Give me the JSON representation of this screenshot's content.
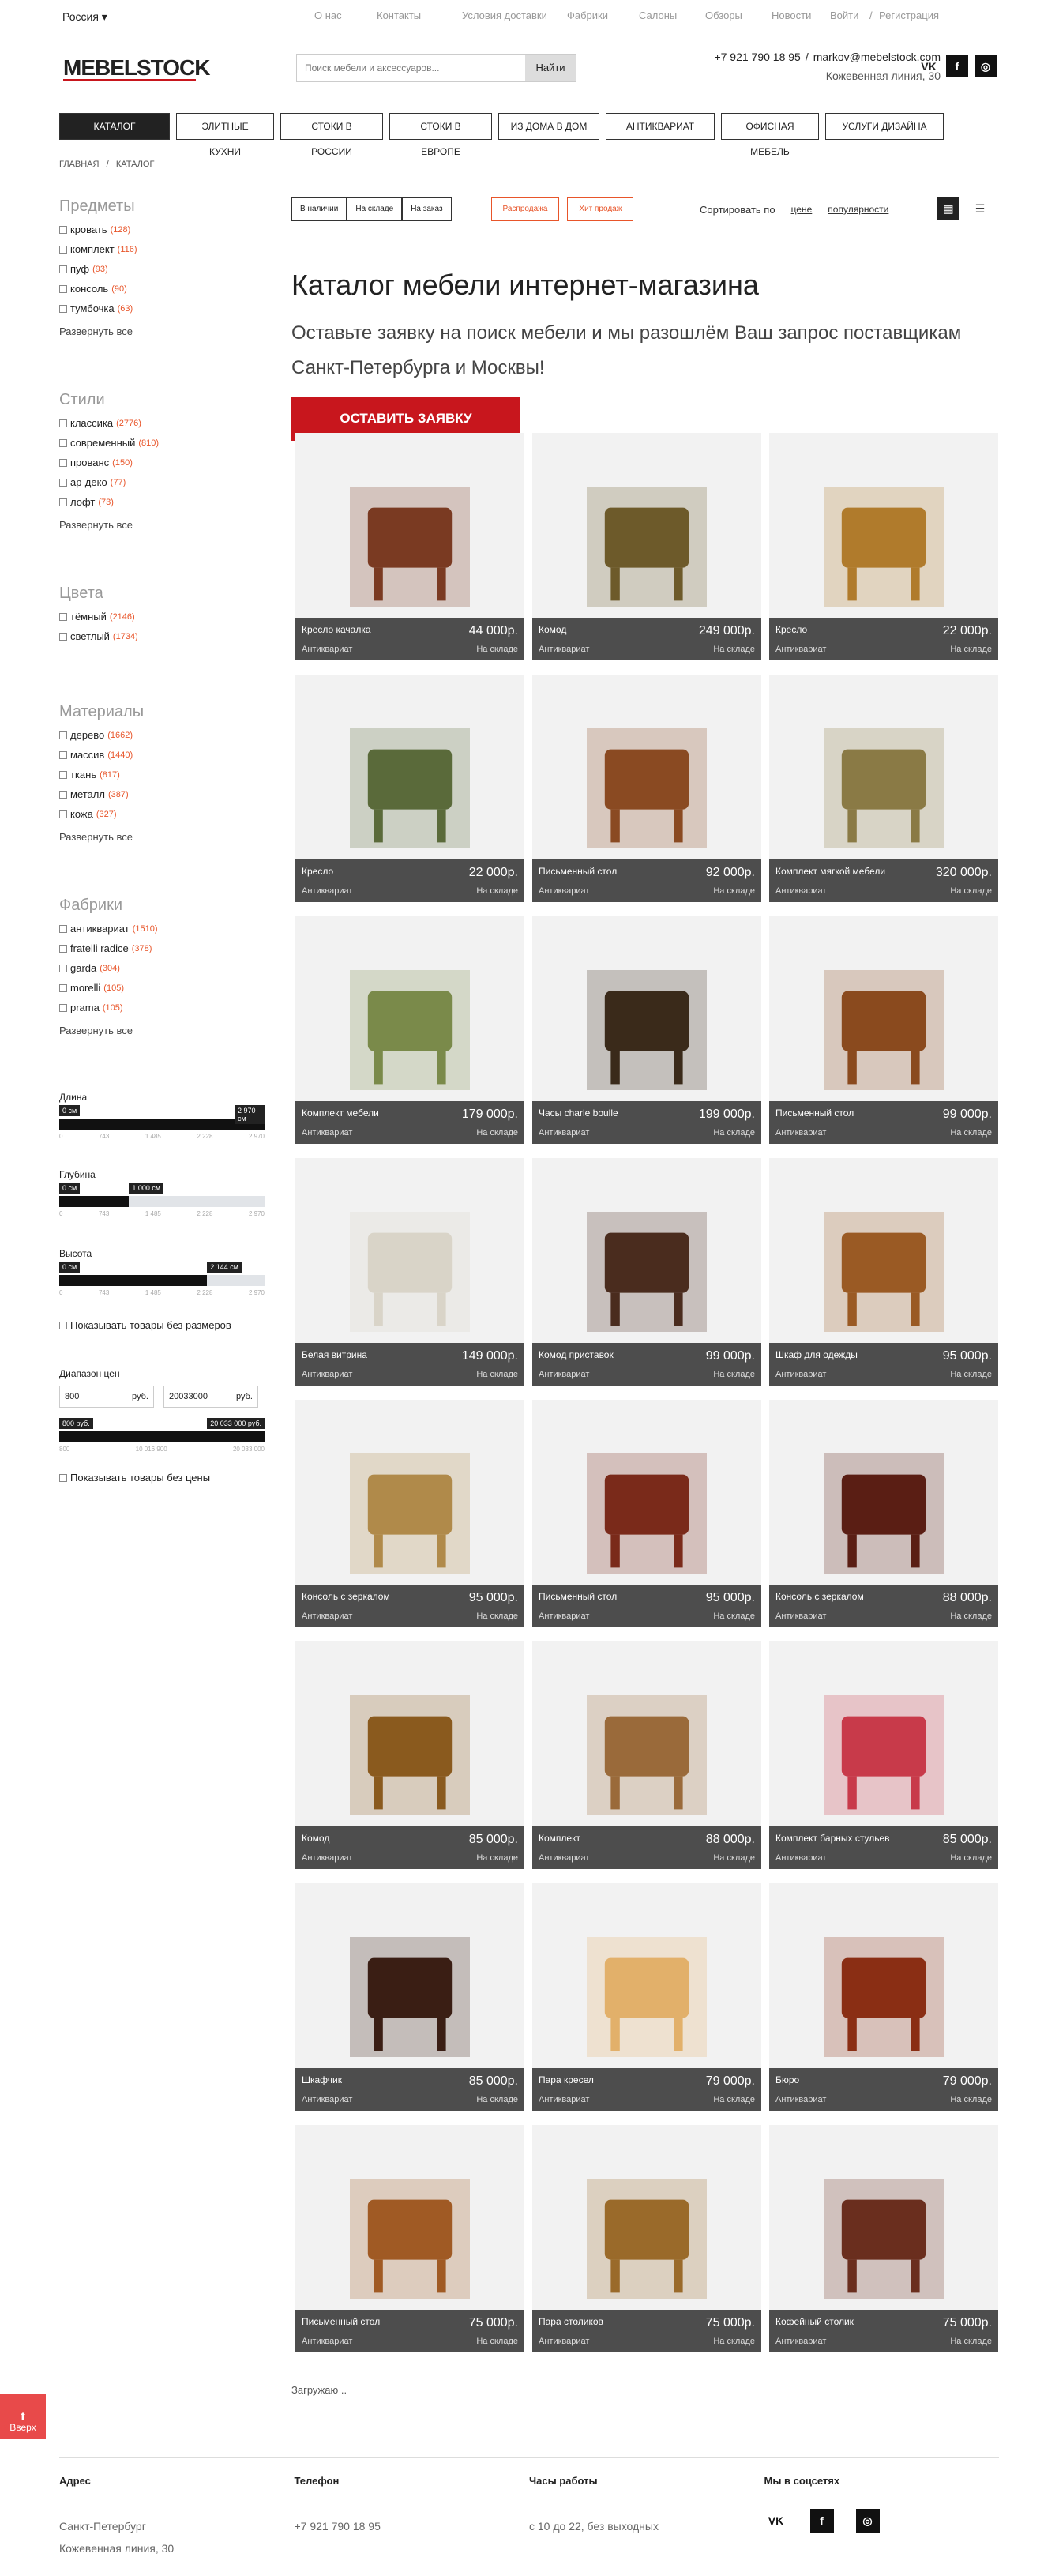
{
  "topbar": {
    "region": "Россия",
    "nav": [
      "О нас",
      "Контакты",
      "Условия доставки",
      "Фабрики",
      "Салоны",
      "Обзоры",
      "Новости",
      "Войти",
      "/",
      "Регистрация"
    ]
  },
  "header": {
    "logo": "MEBELSTOCK",
    "search_placeholder": "Поиск мебели и аксессуаров...",
    "search_button": "Найти",
    "phone": "+7 921 790 18 95",
    "email": "markov@mebelstock.com",
    "address": "Кожевенная линия, 30"
  },
  "mainnav": [
    "КАТАЛОГ",
    "ЭЛИТНЫЕ КУХНИ",
    "СТОКИ В РОССИИ",
    "СТОКИ В ЕВРОПЕ",
    "ИЗ ДОМА В ДОМ",
    "АНТИКВАРИАТ",
    "ОФИСНАЯ МЕБЕЛЬ",
    "УСЛУГИ ДИЗАЙНА"
  ],
  "breadcrumb": {
    "home": "ГЛАВНАЯ",
    "sep": "/",
    "current": "КАТАЛОГ"
  },
  "sidebar": {
    "items": {
      "title": "Предметы",
      "list": [
        {
          "l": "кровать",
          "c": "(128)"
        },
        {
          "l": "комплект",
          "c": "(116)"
        },
        {
          "l": "пуф",
          "c": "(93)"
        },
        {
          "l": "консоль",
          "c": "(90)"
        },
        {
          "l": "тумбочка",
          "c": "(63)"
        }
      ],
      "expand": "Развернуть все"
    },
    "styles": {
      "title": "Стили",
      "list": [
        {
          "l": "классика",
          "c": "(2776)"
        },
        {
          "l": "современный",
          "c": "(810)"
        },
        {
          "l": "прованс",
          "c": "(150)"
        },
        {
          "l": "ар-деко",
          "c": "(77)"
        },
        {
          "l": "лофт",
          "c": "(73)"
        }
      ],
      "expand": "Развернуть все"
    },
    "colors": {
      "title": "Цвета",
      "list": [
        {
          "l": "тёмный",
          "c": "(2146)"
        },
        {
          "l": "светлый",
          "c": "(1734)"
        }
      ]
    },
    "materials": {
      "title": "Материалы",
      "list": [
        {
          "l": "дерево",
          "c": "(1662)"
        },
        {
          "l": "массив",
          "c": "(1440)"
        },
        {
          "l": "ткань",
          "c": "(817)"
        },
        {
          "l": "металл",
          "c": "(387)"
        },
        {
          "l": "кожа",
          "c": "(327)"
        }
      ],
      "expand": "Развернуть все"
    },
    "factories": {
      "title": "Фабрики",
      "list": [
        {
          "l": "антиквариат",
          "c": "(1510)"
        },
        {
          "l": "fratelli radice",
          "c": "(378)"
        },
        {
          "l": "garda",
          "c": "(304)"
        },
        {
          "l": "morelli",
          "c": "(105)"
        },
        {
          "l": "prama",
          "c": "(105)"
        }
      ],
      "expand": "Развернуть все"
    },
    "length": {
      "label": "Длина",
      "min": "0 см",
      "max": "2 970 см",
      "fill": 1.0,
      "ticks": [
        "0",
        "743",
        "1 485",
        "2 228",
        "2 970"
      ]
    },
    "depth": {
      "label": "Глубина",
      "min": "0 см",
      "max": "1 000 см",
      "fill": 0.34,
      "ticks": [
        "0",
        "743",
        "1 485",
        "2 228",
        "2 970"
      ]
    },
    "height": {
      "label": "Высота",
      "min": "0 см",
      "max": "2 144 см",
      "fill": 0.72,
      "ticks": [
        "0",
        "743",
        "1 485",
        "2 228",
        "2 970"
      ]
    },
    "no_size": "Показывать товары без размеров",
    "price": {
      "label": "Диапазон цен",
      "from": "800",
      "to": "20033000",
      "unit": "руб.",
      "min": "800 руб.",
      "max": "20 033 000 руб.",
      "ticks": [
        "800",
        "10 016 900",
        "20 033 000"
      ]
    },
    "no_price": "Показывать товары без цены"
  },
  "filters": {
    "in_stock": [
      "В наличии",
      "На складе",
      "На заказ"
    ],
    "sale": "Распродажа",
    "hit": "Хит продаж",
    "sort_label": "Сортировать по",
    "sort_price": "цене",
    "sort_pop": "популярности"
  },
  "page": {
    "title": "Каталог мебели интернет-магазина",
    "lead": "Оставьте заявку на поиск мебели и мы разошлём Ваш запрос поставщикам Санкт-Петербурга и Москвы!",
    "request": "ОСТАВИТЬ ЗАЯВКУ"
  },
  "products": [
    {
      "name": "Кресло качалка",
      "price": "44 000р.",
      "cat": "Антиквариат",
      "stock": "На складе",
      "color": "#7a3a22"
    },
    {
      "name": "Комод",
      "price": "249 000р.",
      "cat": "Антиквариат",
      "stock": "На складе",
      "color": "#6d5a2a"
    },
    {
      "name": "Кресло",
      "price": "22 000р.",
      "cat": "Антиквариат",
      "stock": "На складе",
      "color": "#b07b2c"
    },
    {
      "name": "Кресло",
      "price": "22 000р.",
      "cat": "Антиквариат",
      "stock": "На складе",
      "color": "#5a6a3a"
    },
    {
      "name": "Письменный стол",
      "price": "92 000р.",
      "cat": "Антиквариат",
      "stock": "На складе",
      "color": "#8a4a22"
    },
    {
      "name": "Комплект мягкой мебели",
      "price": "320 000р.",
      "cat": "Антиквариат",
      "stock": "На складе",
      "color": "#8a7a45"
    },
    {
      "name": "Комплект мебели",
      "price": "179 000р.",
      "cat": "Антиквариат",
      "stock": "На складе",
      "color": "#7a8a4a"
    },
    {
      "name": "Часы charle boulle",
      "price": "199 000р.",
      "cat": "Антиквариат",
      "stock": "На складе",
      "color": "#3a2a1a"
    },
    {
      "name": "Письменный стол",
      "price": "99 000р.",
      "cat": "Антиквариат",
      "stock": "На складе",
      "color": "#8a4a1e"
    },
    {
      "name": "Белая витрина",
      "price": "149 000р.",
      "cat": "Антиквариат",
      "stock": "На складе",
      "color": "#d9d4c8"
    },
    {
      "name": "Комод приставок",
      "price": "99 000р.",
      "cat": "Антиквариат",
      "stock": "На складе",
      "color": "#4a2c1e"
    },
    {
      "name": "Шкаф для одежды",
      "price": "95 000р.",
      "cat": "Антиквариат",
      "stock": "На складе",
      "color": "#9a5a24"
    },
    {
      "name": "Консоль с зеркалом",
      "price": "95 000р.",
      "cat": "Антиквариат",
      "stock": "На складе",
      "color": "#b08a4a"
    },
    {
      "name": "Письменный стол",
      "price": "95 000р.",
      "cat": "Антиквариат",
      "stock": "На складе",
      "color": "#7a2a1a"
    },
    {
      "name": "Консоль с зеркалом",
      "price": "88 000р.",
      "cat": "Антиквариат",
      "stock": "На складе",
      "color": "#5a1e14"
    },
    {
      "name": "Комод",
      "price": "85 000р.",
      "cat": "Антиквариат",
      "stock": "На складе",
      "color": "#8a5a1e"
    },
    {
      "name": "Комплект",
      "price": "88 000р.",
      "cat": "Антиквариат",
      "stock": "На складе",
      "color": "#9a6a3a"
    },
    {
      "name": "Комплект барных стульев",
      "price": "85 000р.",
      "cat": "Антиквариат",
      "stock": "На складе",
      "color": "#c83a4a"
    },
    {
      "name": "Шкафчик",
      "price": "85 000р.",
      "cat": "Антиквариат",
      "stock": "На складе",
      "color": "#3a1e14"
    },
    {
      "name": "Пара кресел",
      "price": "79 000р.",
      "cat": "Антиквариат",
      "stock": "На складе",
      "color": "#e2b06a"
    },
    {
      "name": "Бюро",
      "price": "79 000р.",
      "cat": "Антиквариат",
      "stock": "На складе",
      "color": "#8a2e14"
    },
    {
      "name": "Письменный стол",
      "price": "75 000р.",
      "cat": "Антиквариат",
      "stock": "На складе",
      "color": "#a05a24"
    },
    {
      "name": "Пара столиков",
      "price": "75 000р.",
      "cat": "Антиквариат",
      "stock": "На складе",
      "color": "#9a6a2a"
    },
    {
      "name": "Кофейный столик",
      "price": "75 000р.",
      "cat": "Антиквариат",
      "stock": "На складе",
      "color": "#6a2e1e"
    }
  ],
  "loading": "Загружаю ..",
  "footer": {
    "addr_h": "Адрес",
    "addr": "Санкт-Петербург",
    "addr2": "Кожевенная линия, 30",
    "phone_h": "Телефон",
    "phone": "+7 921 790 18 95",
    "hours_h": "Часы работы",
    "hours": "с 10 до 22, без выходных",
    "social_h": "Мы в соцсетях"
  },
  "up_button": "Вверх"
}
